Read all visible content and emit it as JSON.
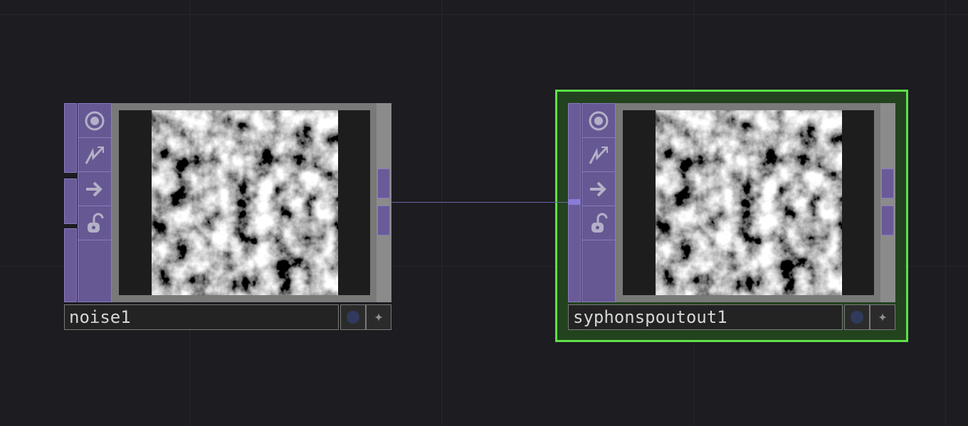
{
  "nodes": [
    {
      "name": "noise1",
      "selected": false
    },
    {
      "name": "syphonspoutout1",
      "selected": true
    }
  ],
  "flags": [
    "viewer-flag-icon",
    "cook-flag-icon",
    "export-flag-icon",
    "lock-icon"
  ],
  "colors": {
    "background": "#1c1c21",
    "node_purple": "#665892",
    "selection": "#5ee04a",
    "wire": "#6d63a6"
  }
}
